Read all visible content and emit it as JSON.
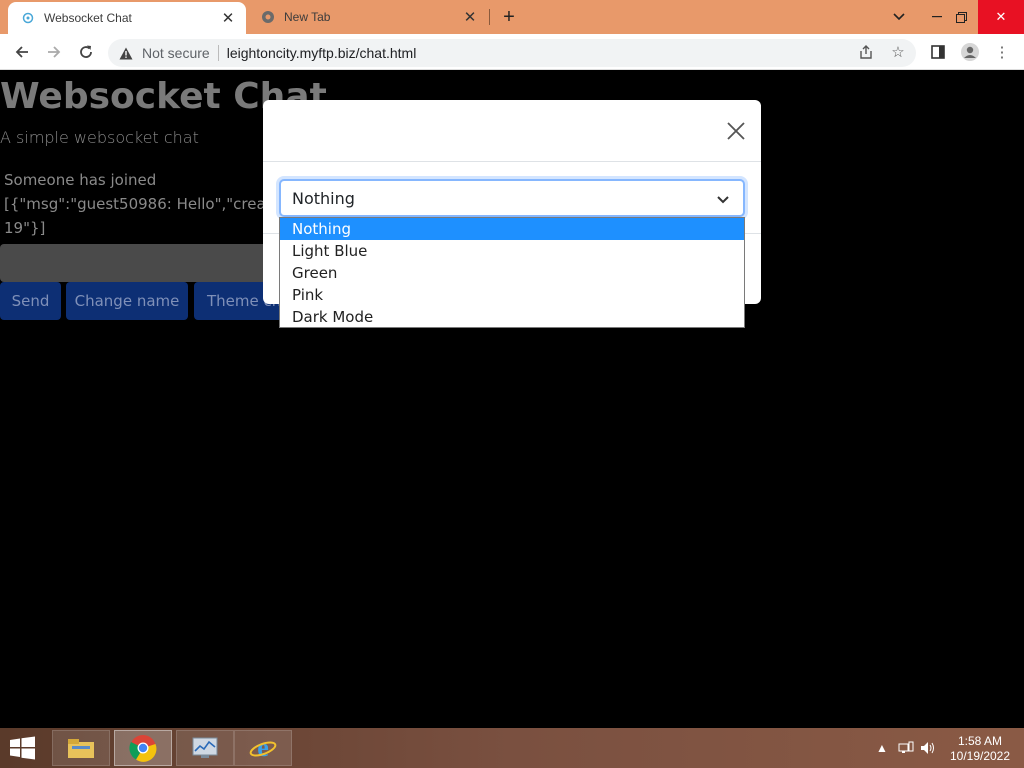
{
  "browser": {
    "tabs": [
      {
        "title": "Websocket Chat",
        "active": true
      },
      {
        "title": "New Tab",
        "active": false
      }
    ],
    "security_label": "Not secure",
    "url": "leightoncity.myftp.biz/chat.html"
  },
  "page": {
    "title": "Websocket Chat",
    "subtitle": "A simple websocket chat",
    "messages": [
      "Someone has joined",
      "[{\"msg\":\"guest50986: Hello\",\"created\"",
      "19\"}]"
    ],
    "buttons": {
      "send": "Send",
      "change_name": "Change name",
      "theme": "Theme ch"
    }
  },
  "modal": {
    "select_value": "Nothing",
    "options": [
      "Nothing",
      "Light Blue",
      "Green",
      "Pink",
      "Dark Mode"
    ],
    "selected_index": 0
  },
  "taskbar": {
    "time": "1:58 AM",
    "date": "10/19/2022"
  },
  "colors": {
    "accent_selected": "#1e90ff",
    "button_bg": "#0d2f74",
    "tabbar_bg": "#e8996a"
  }
}
